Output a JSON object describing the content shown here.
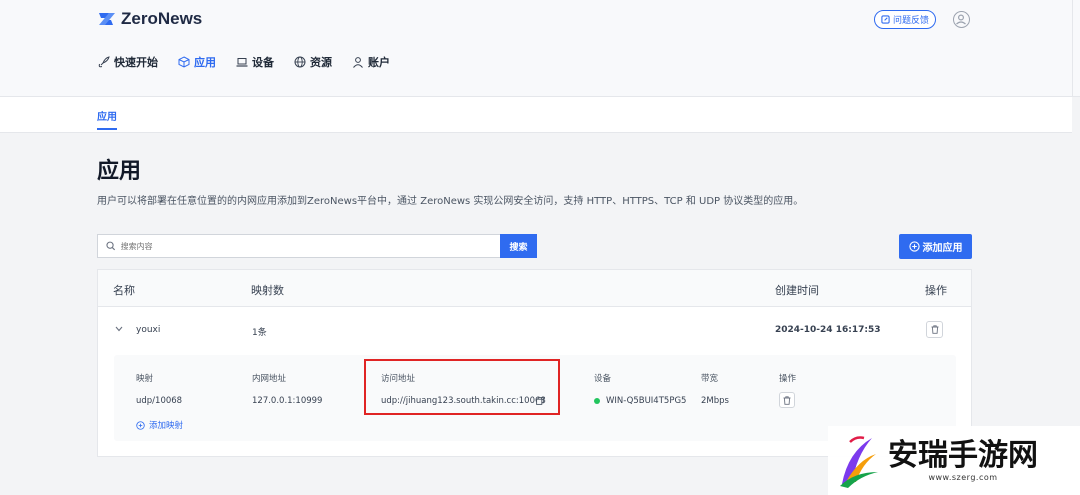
{
  "brand": {
    "name": "ZeroNews",
    "accent": "#2f6bf0"
  },
  "header": {
    "feedback_label": "问题反馈",
    "nav": [
      {
        "label": "快速开始",
        "icon": "rocket-icon"
      },
      {
        "label": "应用",
        "icon": "cube-icon",
        "active": true
      },
      {
        "label": "设备",
        "icon": "laptop-icon"
      },
      {
        "label": "资源",
        "icon": "globe-icon"
      },
      {
        "label": "账户",
        "icon": "user-icon"
      }
    ]
  },
  "subtab": {
    "label": "应用"
  },
  "page": {
    "title": "应用",
    "description": "用户可以将部署在任意位置的的内网应用添加到ZeroNews平台中，通过 ZeroNews 实现公网安全访问，支持 HTTP、HTTPS、TCP 和 UDP 协议类型的应用。"
  },
  "search": {
    "placeholder": "搜索内容",
    "button_label": "搜索"
  },
  "add_app_label": "添加应用",
  "table": {
    "headers": {
      "name": "名称",
      "mappings": "映射数",
      "created": "创建时间",
      "actions": "操作"
    },
    "row": {
      "name": "youxi",
      "mappings": "1条",
      "created": "2024-10-24 16:17:53"
    },
    "detail": {
      "headers": {
        "mapping": "映射",
        "intranet": "内网地址",
        "access": "访问地址",
        "device": "设备",
        "bandwidth": "带宽",
        "actions": "操作"
      },
      "values": {
        "mapping": "udp/10068",
        "intranet": "127.0.0.1:10999",
        "access": "udp://jihuang123.south.takin.cc:10068",
        "device": "WIN-Q5BUI4T5PG5",
        "bandwidth": "2Mbps"
      },
      "add_mapping_label": "添加映射"
    }
  },
  "watermark": {
    "title": "安瑞手游网",
    "url": "www.szerg.com"
  }
}
